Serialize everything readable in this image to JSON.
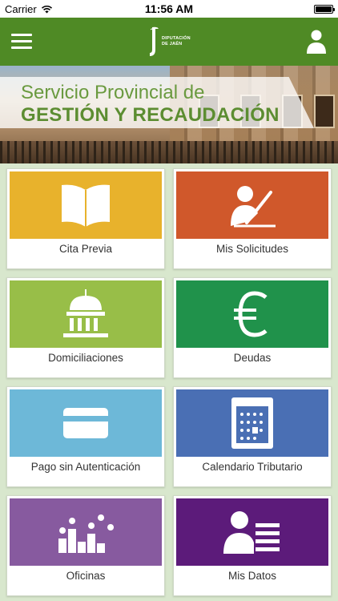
{
  "status_bar": {
    "carrier": "Carrier",
    "time": "11:56 AM",
    "battery_level": 1.0
  },
  "navbar": {
    "logo_text_line1": "DIPUTACIÓN",
    "logo_text_line2": "DE JAÉN",
    "color": "#4f8a25"
  },
  "banner": {
    "line1": "Servicio Provincial de",
    "line2": "GESTIÓN Y RECAUDACIÓN"
  },
  "tiles": [
    {
      "label": "Cita Previa",
      "color": "#e8b22c",
      "icon": "book-icon"
    },
    {
      "label": "Mis Solicitudes",
      "color": "#d0582b",
      "icon": "signing-person-icon"
    },
    {
      "label": "Domiciliaciones",
      "color": "#98be48",
      "icon": "institution-icon"
    },
    {
      "label": "Deudas",
      "color": "#20924b",
      "icon": "euro-icon"
    },
    {
      "label": "Pago sin Autenticación",
      "color": "#6db8d8",
      "icon": "credit-card-icon"
    },
    {
      "label": "Calendario Tributario",
      "color": "#4a6fb4",
      "icon": "calendar-icon"
    },
    {
      "label": "Oficinas",
      "color": "#875a9f",
      "icon": "offices-map-icon"
    },
    {
      "label": "Mis Datos",
      "color": "#5c1b7a",
      "icon": "user-data-icon"
    }
  ]
}
